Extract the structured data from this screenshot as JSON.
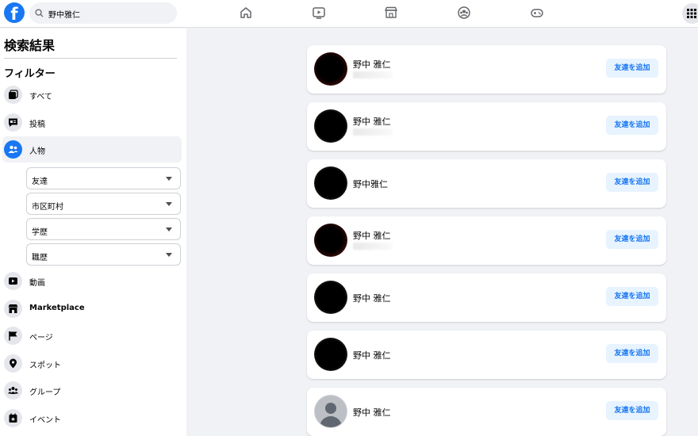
{
  "topbar": {
    "logo_letter": "f",
    "search_value": "野中雅仁",
    "nav_icons": [
      "home-icon",
      "watch-icon",
      "marketplace-icon",
      "groups-icon",
      "gaming-icon"
    ],
    "menu_icon": "grid-menu-icon"
  },
  "sidebar": {
    "title": "検索結果",
    "filter_label": "フィルター",
    "items": [
      {
        "label": "すべて",
        "icon": "all-results-icon"
      },
      {
        "label": "投稿",
        "icon": "posts-icon"
      },
      {
        "label": "人物",
        "icon": "people-icon",
        "active": true
      },
      {
        "label": "動画",
        "icon": "video-icon"
      },
      {
        "label": "Marketplace",
        "icon": "marketplace-icon"
      },
      {
        "label": "ページ",
        "icon": "flag-icon"
      },
      {
        "label": "スポット",
        "icon": "location-icon"
      },
      {
        "label": "グループ",
        "icon": "groups-icon"
      },
      {
        "label": "イベント",
        "icon": "event-icon"
      }
    ],
    "people_filters": [
      "友達",
      "市区町村",
      "学歴",
      "職歴"
    ]
  },
  "results": [
    {
      "name": "野中 雅仁",
      "avatar": "blurred",
      "button": "友達を追加"
    },
    {
      "name": "野中 雅仁",
      "avatar": "blurred",
      "button": "友達を追加"
    },
    {
      "name": "野中雅仁",
      "avatar": "blurred",
      "button": "友達を追加"
    },
    {
      "name": "野中 雅仁",
      "avatar": "blurred",
      "button": "友達を追加"
    },
    {
      "name": "野中 雅仁",
      "avatar": "blurred",
      "button": "友達を追加"
    },
    {
      "name": "野中 雅仁",
      "avatar": "blurred",
      "button": "友達を追加"
    },
    {
      "name": "野中 雅仁",
      "avatar": "default",
      "button": "友達を追加"
    }
  ],
  "colors": {
    "accent": "#1877f2",
    "background": "#f0f2f5",
    "button_bg": "#e7f3ff"
  }
}
